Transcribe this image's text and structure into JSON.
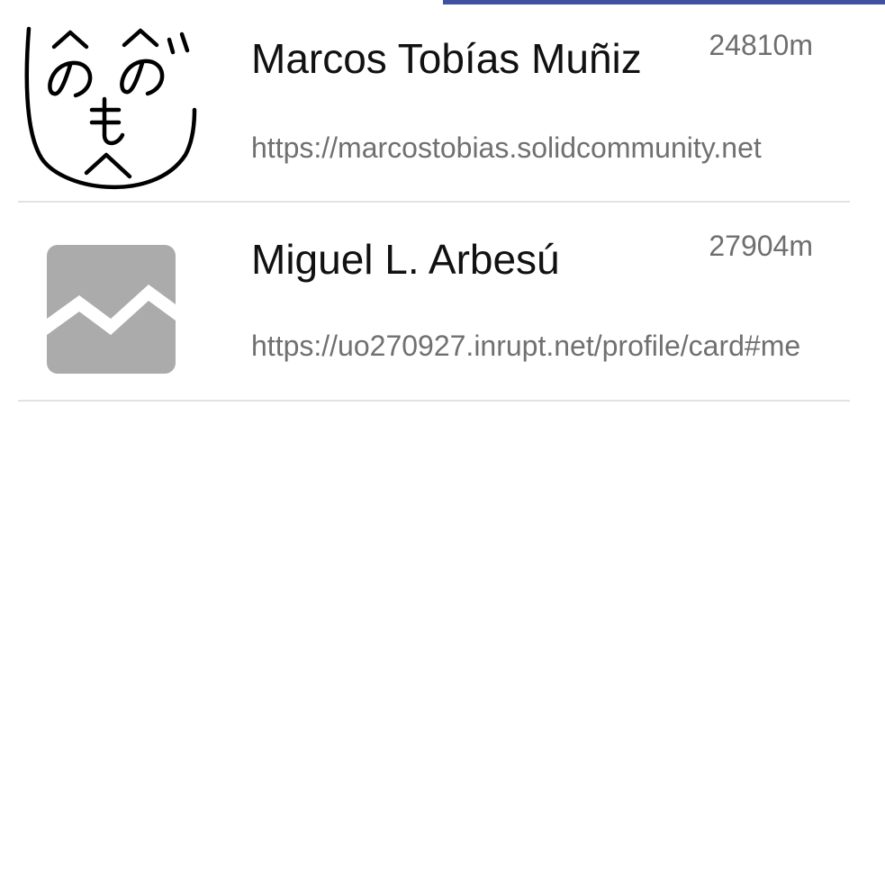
{
  "colors": {
    "top_bar": "#3f51a0",
    "name_text": "#111111",
    "secondary_text": "#707070",
    "divider": "#e2e2e2",
    "placeholder_icon": "#ababab"
  },
  "contacts": [
    {
      "name": "Marcos Tobías Muñiz",
      "distance": "24810m",
      "url": "https://marcostobias.solidcommunity.net",
      "avatar_icon": "henohenomoheji-face-icon"
    },
    {
      "name": "Miguel L. Arbesú",
      "distance": "27904m",
      "url": "https://uo270927.inrupt.net/profile/card#me",
      "avatar_icon": "broken-image-icon"
    }
  ]
}
